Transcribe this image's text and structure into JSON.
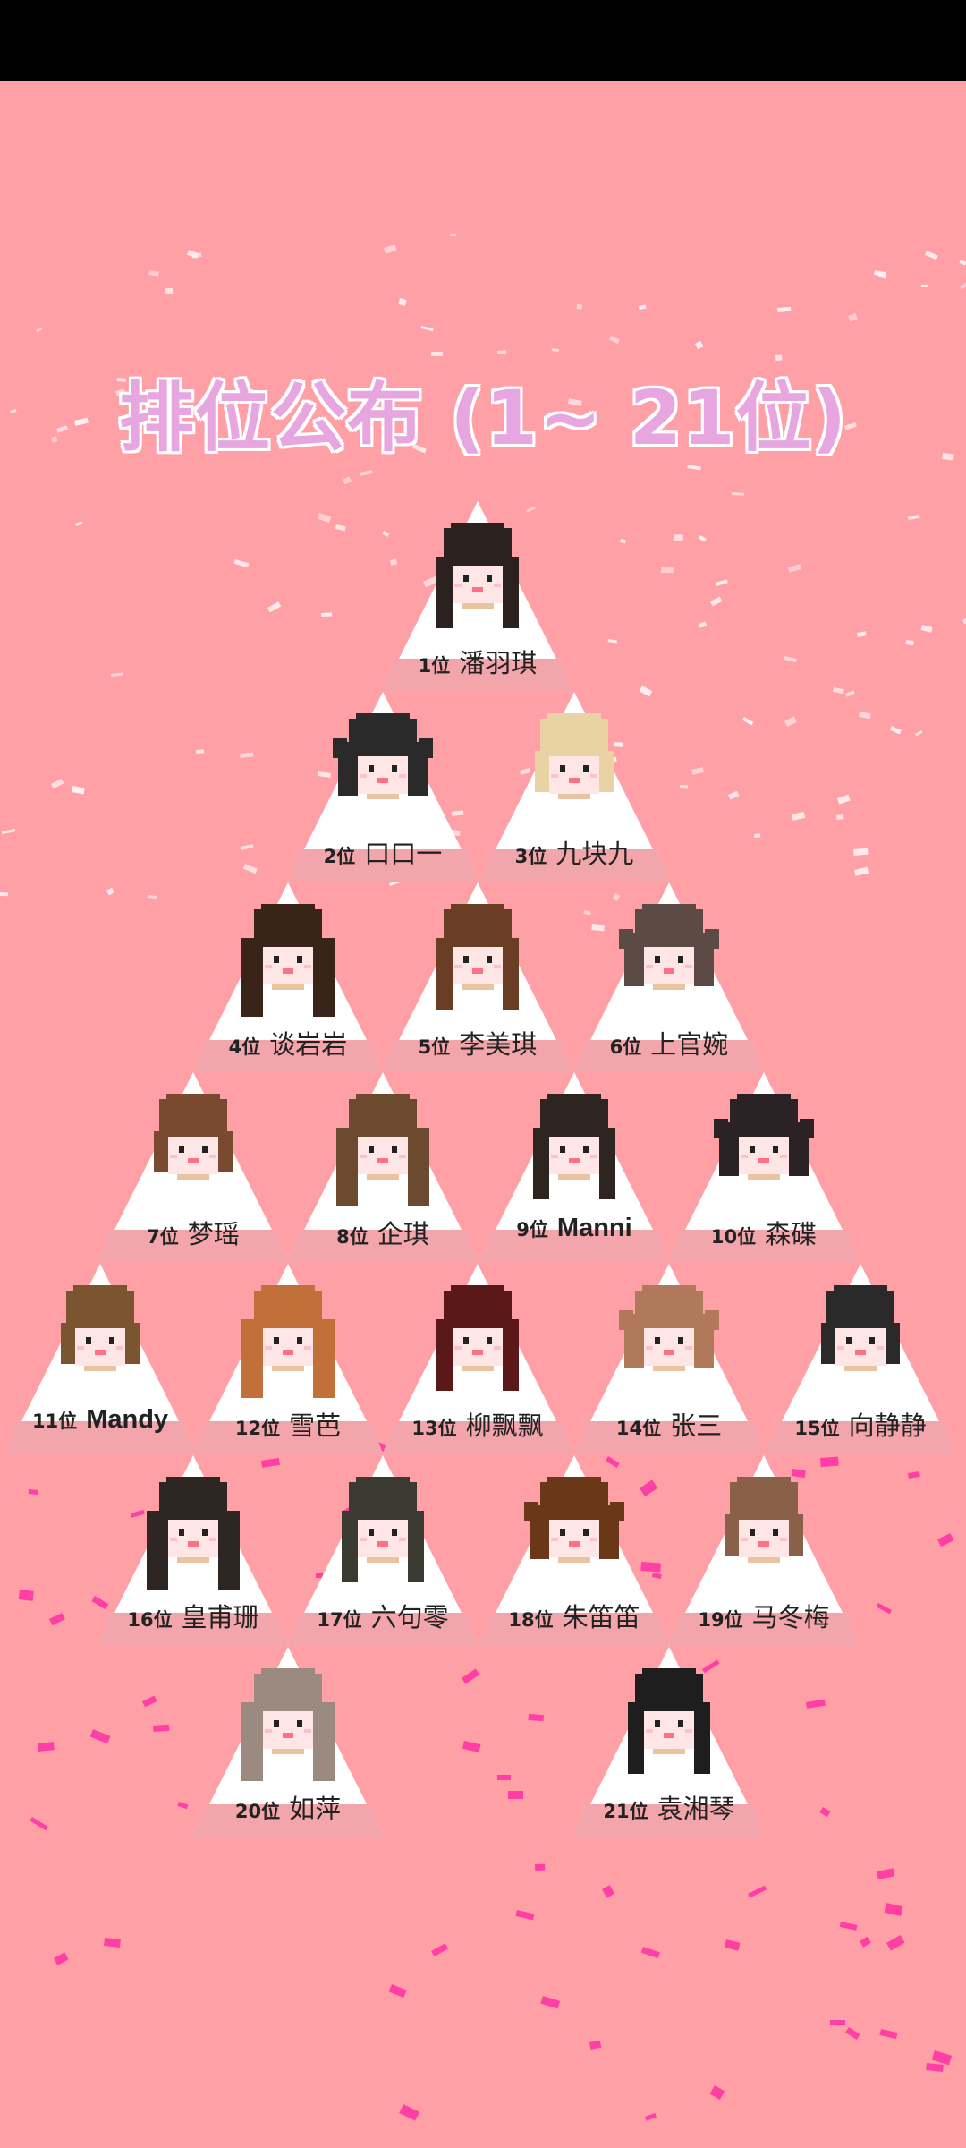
{
  "title": "排位公布 (1~ 21位)",
  "colors": {
    "background": "#ffa0a6",
    "title": "#e7a6df",
    "card": "#ffffff",
    "card_band": "#f3a5ac",
    "skin": "#ffe6e6",
    "mouth": "#ff6f86",
    "confetti_white": "#fff3f3",
    "confetti_pink": "#ff3fa5"
  },
  "ranking": [
    {
      "rank_label": "1位",
      "name": "潘羽琪",
      "hair": "#2b2220"
    },
    {
      "rank_label": "2位",
      "name": "口口一",
      "hair": "#2a2a2a"
    },
    {
      "rank_label": "3位",
      "name": "九块九",
      "hair": "#e9d3a4"
    },
    {
      "rank_label": "4位",
      "name": "谈岩岩",
      "hair": "#3a2419"
    },
    {
      "rank_label": "5位",
      "name": "李美琪",
      "hair": "#6a3e25"
    },
    {
      "rank_label": "6位",
      "name": "上官婉",
      "hair": "#5c4b44"
    },
    {
      "rank_label": "7位",
      "name": "梦瑶",
      "hair": "#7a4a30"
    },
    {
      "rank_label": "8位",
      "name": "企琪",
      "hair": "#6c4a30"
    },
    {
      "rank_label": "9位",
      "name": "Manni",
      "hair": "#2e2420"
    },
    {
      "rank_label": "10位",
      "name": "森碟",
      "hair": "#2a2224"
    },
    {
      "rank_label": "11位",
      "name": "Mandy",
      "hair": "#7a5530"
    },
    {
      "rank_label": "12位",
      "name": "雪芭",
      "hair": "#c2703a"
    },
    {
      "rank_label": "13位",
      "name": "柳飘飘",
      "hair": "#5a1818"
    },
    {
      "rank_label": "14位",
      "name": "张三",
      "hair": "#b07a5a"
    },
    {
      "rank_label": "15位",
      "name": "向静静",
      "hair": "#2a2a2a"
    },
    {
      "rank_label": "16位",
      "name": "皇甫珊",
      "hair": "#2e2622"
    },
    {
      "rank_label": "17位",
      "name": "六句零",
      "hair": "#3a3a30"
    },
    {
      "rank_label": "18位",
      "name": "朱笛笛",
      "hair": "#6a3818"
    },
    {
      "rank_label": "19位",
      "name": "马冬梅",
      "hair": "#8a6048"
    },
    {
      "rank_label": "20位",
      "name": "如萍",
      "hair": "#9a8a80"
    },
    {
      "rank_label": "21位",
      "name": "袁湘琴",
      "hair": "#1e1e1e"
    }
  ]
}
